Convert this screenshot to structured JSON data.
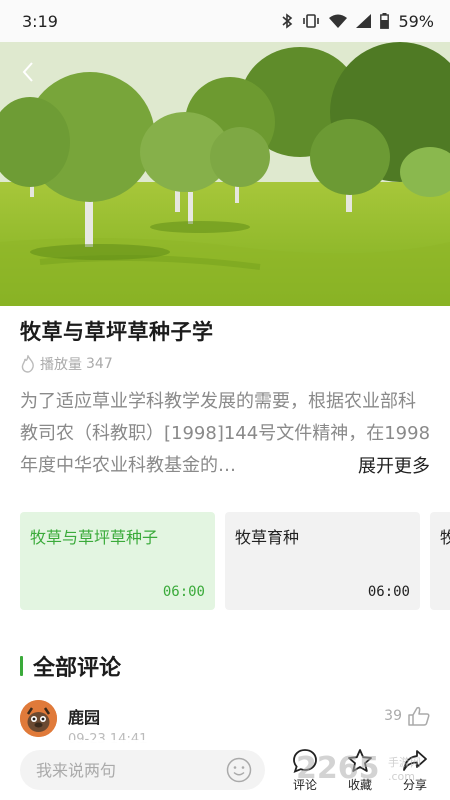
{
  "status": {
    "time": "3:19",
    "battery": "59%"
  },
  "course": {
    "title": "牧草与草坪草种子学",
    "plays_label": "播放量",
    "plays": "347",
    "description": "为了适应草业学科教学发展的需要，根据农业部科教司农（科教职）[1998]144号文件精神，在1998年度中华农业科教基金的…",
    "expand_label": "展开更多"
  },
  "episodes": [
    {
      "title": "牧草与草坪草种子",
      "duration": "06:00",
      "active": true
    },
    {
      "title": "牧草育种",
      "duration": "06:00",
      "active": false
    },
    {
      "title": "牧",
      "duration": "",
      "active": false
    }
  ],
  "comments_section": {
    "title": "全部评论",
    "items": [
      {
        "user": "鹿园",
        "time": "09-23 14:41",
        "likes": "39"
      }
    ]
  },
  "bottom": {
    "input_placeholder": "我来说两句",
    "comment_label": "评论",
    "favorite_label": "收藏",
    "share_label": "分享"
  },
  "watermark": {
    "text": "2265.com",
    "sub": "手游网"
  },
  "colors": {
    "accent": "#3aaa3a",
    "active_card_bg": "#e3f5e1",
    "card_bg": "#f2f2f2"
  }
}
